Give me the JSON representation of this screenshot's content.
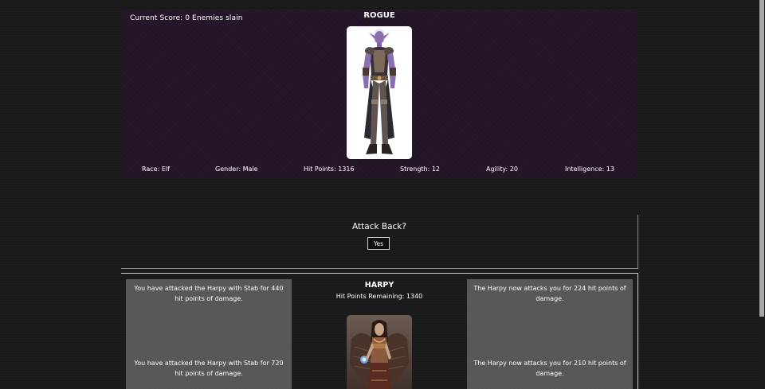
{
  "player": {
    "score_text": "Current Score: 0 Enemies slain",
    "class_name": "ROGUE",
    "stats": {
      "race": "Race: Elf",
      "gender": "Gender: Male",
      "hit_points": "Hit Points: 1316",
      "strength": "Strength: 12",
      "agility": "Agility: 20",
      "intelligence": "Intelligence: 13"
    },
    "panel_color": "#241628"
  },
  "attack": {
    "prompt": "Attack Back?",
    "yes_label": "Yes"
  },
  "enemy": {
    "name": "HARPY",
    "hp_text": "Hit Points Remaining: 1340"
  },
  "log": {
    "player_attacks": [
      "You have attacked the Harpy with Stab for 440 hit points of damage.",
      "You have attacked the Harpy with Stab for 720 hit points of damage."
    ],
    "enemy_attacks": [
      "The Harpy now attacks you for 224 hit points of damage.",
      "The Harpy now attacks you for 210 hit points of damage."
    ]
  }
}
